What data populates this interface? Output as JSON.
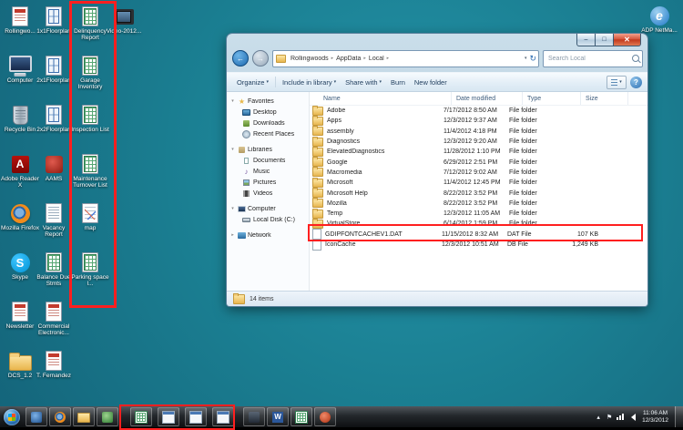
{
  "annotation_color": "#ff1f1f",
  "desktop": {
    "background": "#1b8093",
    "columns": [
      {
        "name": "column-1",
        "items": [
          {
            "label": "Rollingwo...",
            "icon": "doc-red"
          },
          {
            "label": "Computer",
            "icon": "computer"
          },
          {
            "label": "Recycle Bin",
            "icon": "recycle"
          },
          {
            "label": "Adobe Reader X",
            "icon": "adobe"
          },
          {
            "label": "Mozilla Firefox",
            "icon": "firefox"
          },
          {
            "label": "Skype",
            "icon": "skype"
          },
          {
            "label": "Newsletter",
            "icon": "doc-red"
          },
          {
            "label": "DCS_1.2",
            "icon": "folder"
          }
        ]
      },
      {
        "name": "column-2",
        "items": [
          {
            "label": "1x1Floorplan",
            "icon": "blueprint"
          },
          {
            "label": "2x1Floorplan",
            "icon": "blueprint"
          },
          {
            "label": "2x2Floorplan",
            "icon": "blueprint"
          },
          {
            "label": "AAMS",
            "icon": "app-red"
          },
          {
            "label": "Vacancy Report",
            "icon": "doc"
          },
          {
            "label": "Balance Due Stmts",
            "icon": "excel"
          },
          {
            "label": "Commercial Electronic...",
            "icon": "doc-red"
          },
          {
            "label": "T. Fernandez",
            "icon": "doc-red"
          }
        ]
      },
      {
        "name": "column-3",
        "items": [
          {
            "label": "Delinquency Report",
            "icon": "excel"
          },
          {
            "label": "Garage Inventory",
            "icon": "excel"
          },
          {
            "label": "Inspection List",
            "icon": "excel"
          },
          {
            "label": "Maintenance Turnover List",
            "icon": "excel"
          },
          {
            "label": "map",
            "icon": "map"
          },
          {
            "label": "Parking space l...",
            "icon": "excel"
          }
        ]
      },
      {
        "name": "column-4",
        "items": [
          {
            "label": "Video-2012...",
            "icon": "video"
          }
        ]
      }
    ],
    "top_right_icon": {
      "label": "ADP NetMa...",
      "icon": "ie"
    }
  },
  "explorer": {
    "breadcrumb": [
      "Rollingwoods",
      "AppData",
      "Local"
    ],
    "search_placeholder": "Search Local",
    "toolbar": [
      {
        "label": "Organize",
        "dropdown": true
      },
      {
        "label": "Include in library",
        "dropdown": true
      },
      {
        "label": "Share with",
        "dropdown": true
      },
      {
        "label": "Burn",
        "dropdown": false
      },
      {
        "label": "New folder",
        "dropdown": false
      }
    ],
    "nav": [
      {
        "label": "Favorites",
        "expanded": true,
        "children": [
          "Desktop",
          "Downloads",
          "Recent Places"
        ]
      },
      {
        "label": "Libraries",
        "expanded": true,
        "children": [
          "Documents",
          "Music",
          "Pictures",
          "Videos"
        ]
      },
      {
        "label": "Computer",
        "expanded": true,
        "children": [
          "Local Disk (C:)"
        ]
      },
      {
        "label": "Network",
        "expanded": false,
        "children": []
      }
    ],
    "columns": [
      "Name",
      "Date modified",
      "Type",
      "Size"
    ],
    "files": [
      {
        "name": "Adobe",
        "date": "7/17/2012 8:50 AM",
        "type": "File folder",
        "size": "",
        "icon": "folder"
      },
      {
        "name": "Apps",
        "date": "12/3/2012 9:37 AM",
        "type": "File folder",
        "size": "",
        "icon": "folder"
      },
      {
        "name": "assembly",
        "date": "11/4/2012 4:18 PM",
        "type": "File folder",
        "size": "",
        "icon": "folder"
      },
      {
        "name": "Diagnostics",
        "date": "12/3/2012 9:20 AM",
        "type": "File folder",
        "size": "",
        "icon": "folder"
      },
      {
        "name": "ElevatedDiagnostics",
        "date": "11/28/2012 1:10 PM",
        "type": "File folder",
        "size": "",
        "icon": "folder"
      },
      {
        "name": "Google",
        "date": "6/29/2012 2:51 PM",
        "type": "File folder",
        "size": "",
        "icon": "folder"
      },
      {
        "name": "Macromedia",
        "date": "7/12/2012 9:02 AM",
        "type": "File folder",
        "size": "",
        "icon": "folder"
      },
      {
        "name": "Microsoft",
        "date": "11/4/2012 12:45 PM",
        "type": "File folder",
        "size": "",
        "icon": "folder"
      },
      {
        "name": "Microsoft Help",
        "date": "8/22/2012 3:52 PM",
        "type": "File folder",
        "size": "",
        "icon": "folder"
      },
      {
        "name": "Mozilla",
        "date": "8/22/2012 3:52 PM",
        "type": "File folder",
        "size": "",
        "icon": "folder"
      },
      {
        "name": "Temp",
        "date": "12/3/2012 11:05 AM",
        "type": "File folder",
        "size": "",
        "icon": "folder"
      },
      {
        "name": "VirtualStore",
        "date": "6/14/2012 1:59 PM",
        "type": "File folder",
        "size": "",
        "icon": "folder"
      },
      {
        "name": "GDIPFONTCACHEV1.DAT",
        "date": "11/15/2012 8:32 AM",
        "type": "DAT File",
        "size": "107 KB",
        "icon": "file"
      },
      {
        "name": "IconCache",
        "date": "12/3/2012 10:51 AM",
        "type": "DB File",
        "size": "1,249 KB",
        "icon": "file",
        "highlighted": true
      }
    ],
    "status": "14 items"
  },
  "taskbar": {
    "left_icons": [
      "app-blue",
      "firefox",
      "explorer",
      "app-green"
    ],
    "highlighted_icons": [
      "excel",
      "app-window",
      "app-window",
      "app-window"
    ],
    "right_icons": [
      "app-dark",
      "word",
      "excel",
      "app-red"
    ],
    "tray": {
      "icons": [
        "hidden-icons",
        "action-center",
        "network",
        "volume"
      ],
      "time": "11:06 AM",
      "date": "12/3/2012"
    }
  }
}
